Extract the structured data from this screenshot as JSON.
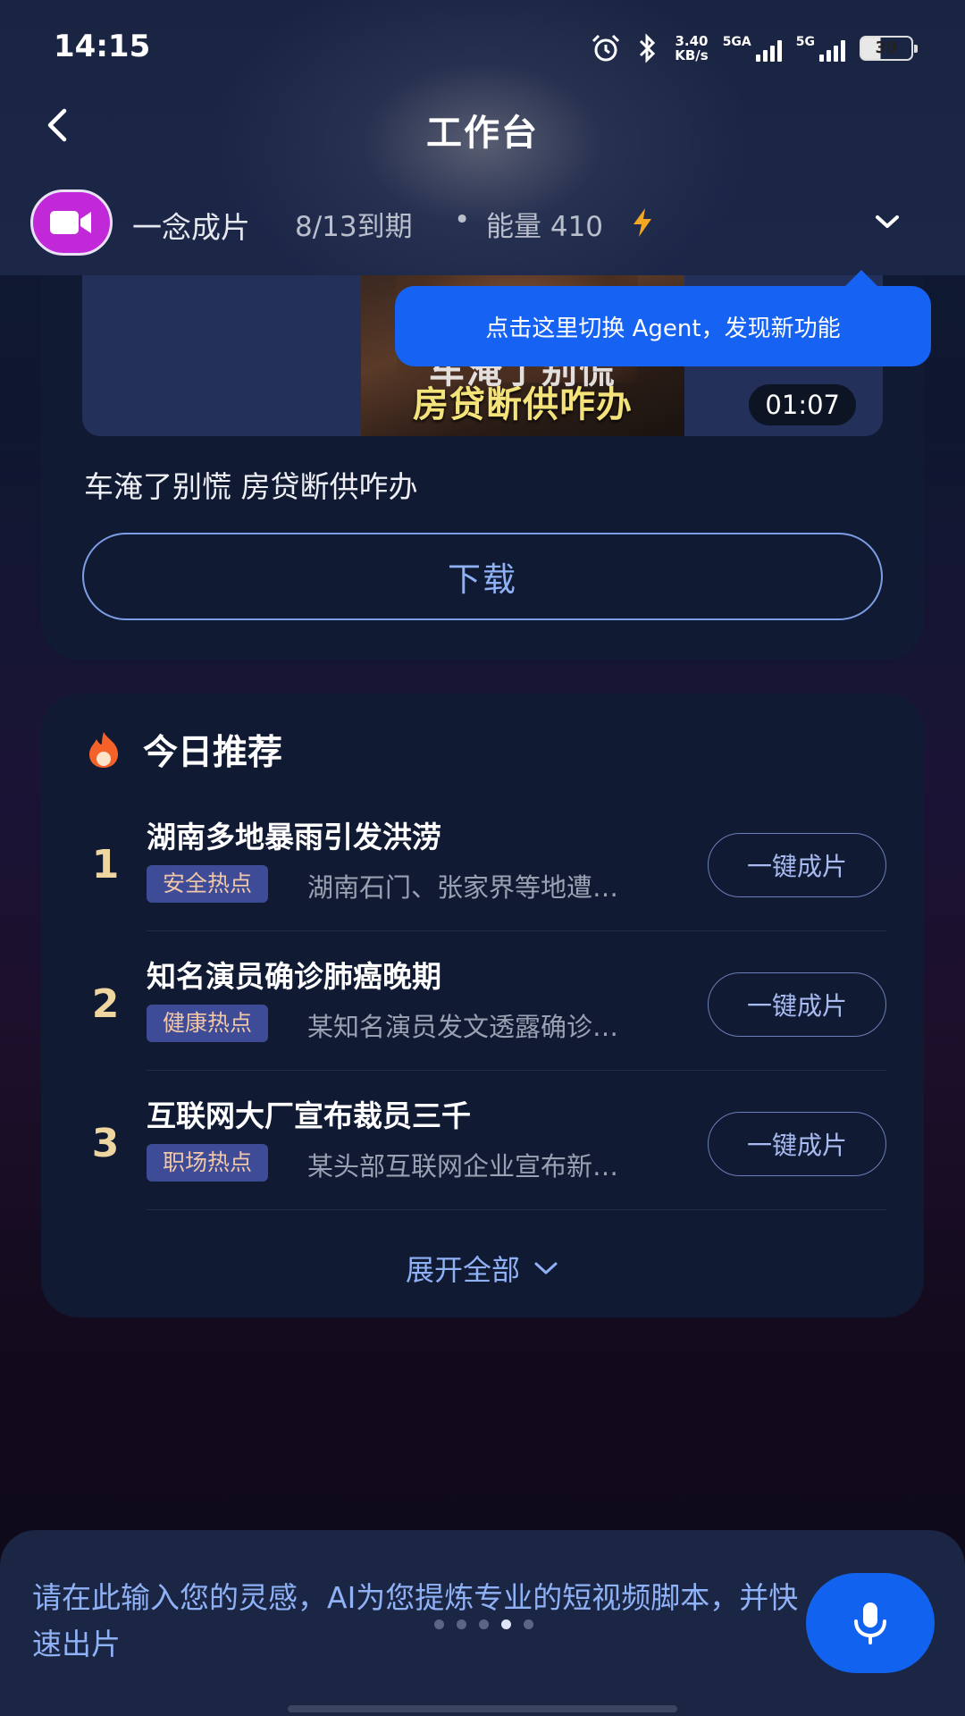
{
  "status_bar": {
    "time": "14:15",
    "net_speed_value": "3.40",
    "net_speed_unit": "KB/s",
    "signal1_label": "5GA",
    "signal2_label": "5G",
    "battery": "39"
  },
  "header": {
    "title": "工作台",
    "agent": {
      "name": "一念成片",
      "expiry": "8/13到期",
      "separator": "•",
      "energy": "能量 410"
    }
  },
  "tooltip": {
    "text": "点击这里切换 Agent，发现新功能"
  },
  "video": {
    "thumbnail_caption_top": "车淹了别慌",
    "thumbnail_caption_bottom": "房贷断供咋办",
    "duration": "01:07",
    "title": "车淹了别慌 房贷断供咋办",
    "download_label": "下载"
  },
  "recommendations": {
    "title": "今日推荐",
    "items": [
      {
        "rank": "1",
        "title": "湖南多地暴雨引发洪涝",
        "tag": "安全热点",
        "desc": "湖南石门、张家界等地遭…",
        "action": "一键成片"
      },
      {
        "rank": "2",
        "title": "知名演员确诊肺癌晚期",
        "tag": "健康热点",
        "desc": "某知名演员发文透露确诊…",
        "action": "一键成片"
      },
      {
        "rank": "3",
        "title": "互联网大厂宣布裁员三千",
        "tag": "职场热点",
        "desc": "某头部互联网企业宣布新…",
        "action": "一键成片"
      }
    ],
    "expand_label": "展开全部"
  },
  "input": {
    "placeholder": "请在此输入您的灵感，AI为您提炼专业的短视频脚本，并快速出片",
    "page_dots_total": 5,
    "page_dots_active": 4
  },
  "colors": {
    "accent_blue": "#1662f2",
    "tag_bg": "#3e4b96",
    "rank_gold": "#efd6a0",
    "energy_orange": "#f5a623"
  }
}
